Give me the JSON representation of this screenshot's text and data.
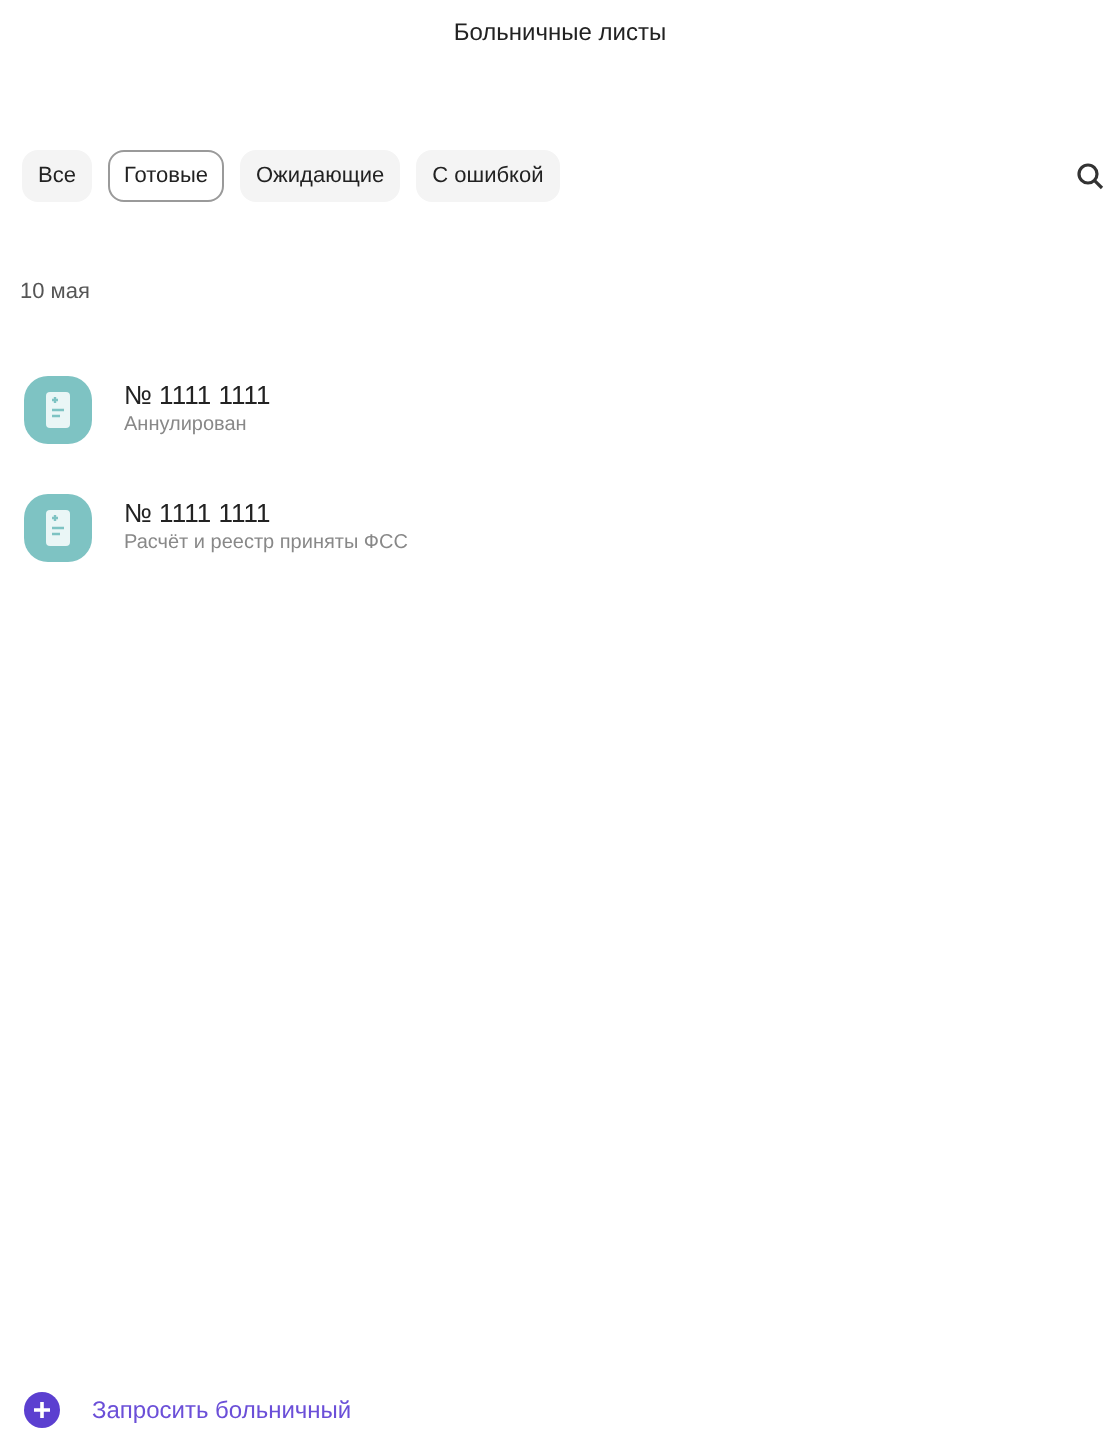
{
  "header": {
    "title": "Больничные листы"
  },
  "filters": [
    {
      "label": "Все",
      "selected": false
    },
    {
      "label": "Готовые",
      "selected": true
    },
    {
      "label": "Ожидающие",
      "selected": false
    },
    {
      "label": "С ошибкой",
      "selected": false
    }
  ],
  "groups": [
    {
      "date": "10 мая",
      "items": [
        {
          "number": "№ 1111 1111",
          "status": "Аннулирован"
        },
        {
          "number": "№ 1111 1111",
          "status": "Расчёт и реестр приняты ФСС"
        }
      ]
    }
  ],
  "action": {
    "label": "Запросить больничный"
  }
}
